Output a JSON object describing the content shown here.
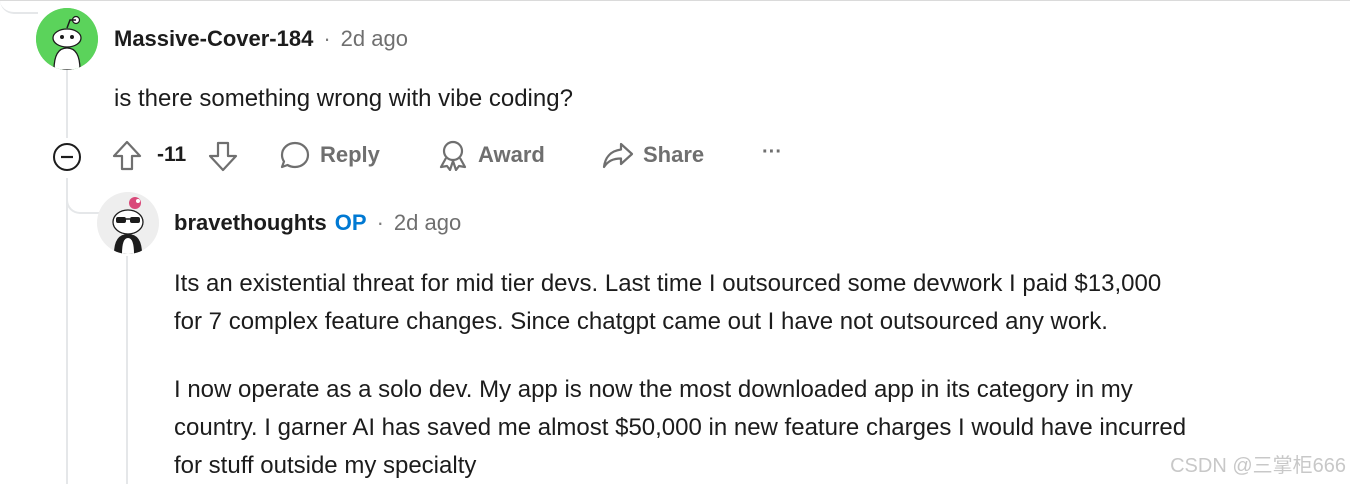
{
  "comment": {
    "username": "Massive-Cover-184",
    "separator": "·",
    "time": "2d ago",
    "text": "is there something wrong with vibe coding?",
    "score": "-11",
    "actions": {
      "reply": "Reply",
      "award": "Award",
      "share": "Share",
      "more": "···"
    }
  },
  "reply": {
    "username": "bravethoughts",
    "op_badge": "OP",
    "separator": "·",
    "time": "2d ago",
    "paragraphs": [
      [
        "Its an existential threat for mid tier devs. Last time I outsourced some devwork I paid $13,000",
        "for 7 complex feature changes. Since chatgpt came out I have not outsourced any work."
      ],
      [
        "I now operate as a solo dev. My app is now the most downloaded app in its category in my",
        "country. I garner AI has saved me almost $50,000 in new feature charges I would have incurred",
        "for stuff outside my specialty"
      ]
    ]
  },
  "watermark": "CSDN @三掌柜666",
  "colors": {
    "avatar_green": "#5bd35b",
    "op_blue": "#0079d3",
    "meta_gray": "#6f6f6f",
    "thread_line": "#e5e7e9"
  }
}
